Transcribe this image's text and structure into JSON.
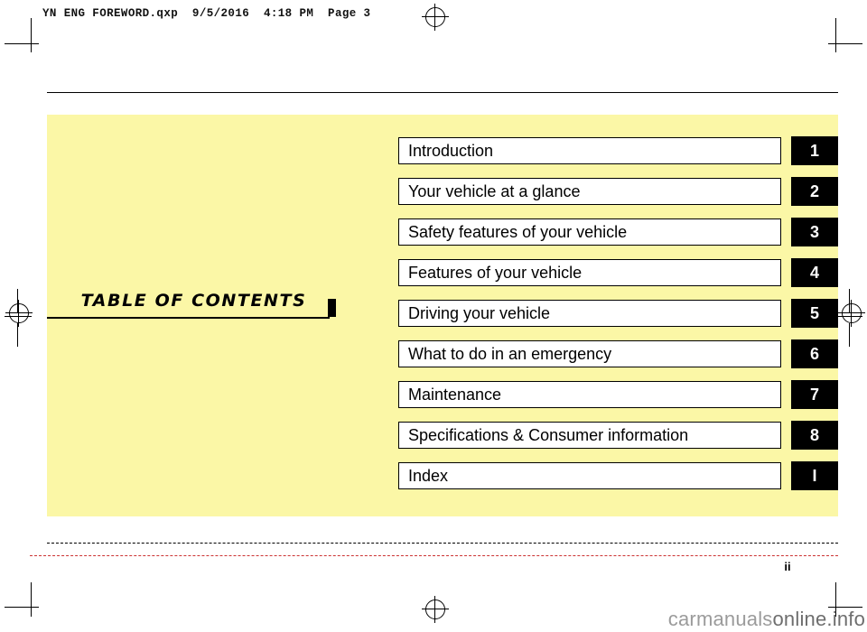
{
  "print_header": "YN ENG FOREWORD.qxp  9/5/2016  4:18 PM  Page 3",
  "toc": {
    "title": "TABLE  OF  CONTENTS",
    "items": [
      {
        "label": "Introduction",
        "tab": "1"
      },
      {
        "label": "Your vehicle at a glance",
        "tab": "2"
      },
      {
        "label": "Safety features of your vehicle",
        "tab": "3"
      },
      {
        "label": "Features of your vehicle",
        "tab": "4"
      },
      {
        "label": "Driving your vehicle",
        "tab": "5"
      },
      {
        "label": "What to do in an emergency",
        "tab": "6"
      },
      {
        "label": "Maintenance",
        "tab": "7"
      },
      {
        "label": "Specifications & Consumer information",
        "tab": "8"
      },
      {
        "label": "Index",
        "tab": "I"
      }
    ]
  },
  "folio": "ii",
  "watermark": {
    "light": "carmanuals",
    "dark": "online.info"
  },
  "colors": {
    "panel": "#fbf7a6",
    "tab": "#000000",
    "text": "#000000"
  }
}
